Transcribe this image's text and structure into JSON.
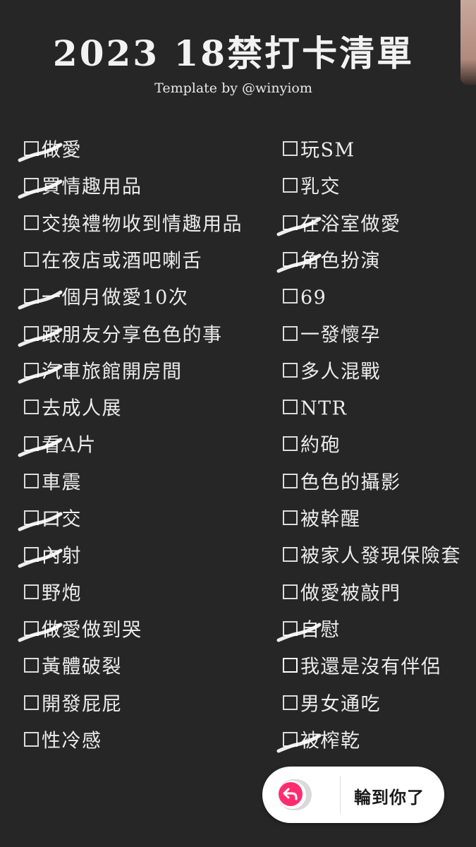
{
  "header": {
    "title": "2023 18禁打卡清單",
    "subtitle": "Template by @winyiom"
  },
  "checklist": {
    "left": [
      {
        "label": "做愛",
        "checked": true
      },
      {
        "label": "買情趣用品",
        "checked": true
      },
      {
        "label": "交換禮物收到情趣用品",
        "checked": false
      },
      {
        "label": "在夜店或酒吧喇舌",
        "checked": false
      },
      {
        "label": "一個月做愛10次",
        "checked": true
      },
      {
        "label": "跟朋友分享色色的事",
        "checked": true
      },
      {
        "label": "汽車旅館開房間",
        "checked": true
      },
      {
        "label": "去成人展",
        "checked": false
      },
      {
        "label": "看A片",
        "checked": true
      },
      {
        "label": "車震",
        "checked": false
      },
      {
        "label": "口交",
        "checked": true
      },
      {
        "label": "內射",
        "checked": true
      },
      {
        "label": "野炮",
        "checked": false
      },
      {
        "label": "做愛做到哭",
        "checked": true
      },
      {
        "label": "黃體破裂",
        "checked": false
      },
      {
        "label": "開發屁屁",
        "checked": false
      },
      {
        "label": "性冷感",
        "checked": false
      }
    ],
    "right": [
      {
        "label": "玩SM",
        "checked": false
      },
      {
        "label": "乳交",
        "checked": false
      },
      {
        "label": "在浴室做愛",
        "checked": true
      },
      {
        "label": "角色扮演",
        "checked": true
      },
      {
        "label": "69",
        "checked": false
      },
      {
        "label": "一發懷孕",
        "checked": false
      },
      {
        "label": "多人混戰",
        "checked": false
      },
      {
        "label": "NTR",
        "checked": false
      },
      {
        "label": "約砲",
        "checked": false
      },
      {
        "label": "色色的攝影",
        "checked": false
      },
      {
        "label": "被幹醒",
        "checked": false
      },
      {
        "label": "被家人發現保險套",
        "checked": false
      },
      {
        "label": "做愛被敲門",
        "checked": false
      },
      {
        "label": "自慰",
        "checked": true
      },
      {
        "label": "我還是沒有伴侶",
        "checked": false
      },
      {
        "label": "男女通吃",
        "checked": false
      },
      {
        "label": "被榨乾",
        "checked": true
      }
    ]
  },
  "reply_prompt": {
    "label": "輪到你了",
    "icon": "reply-arrow-icon",
    "accent_color": "#ff2d6f"
  },
  "colors": {
    "background": "#262626",
    "text": "#ececec",
    "check_mark": "#ffffff"
  }
}
